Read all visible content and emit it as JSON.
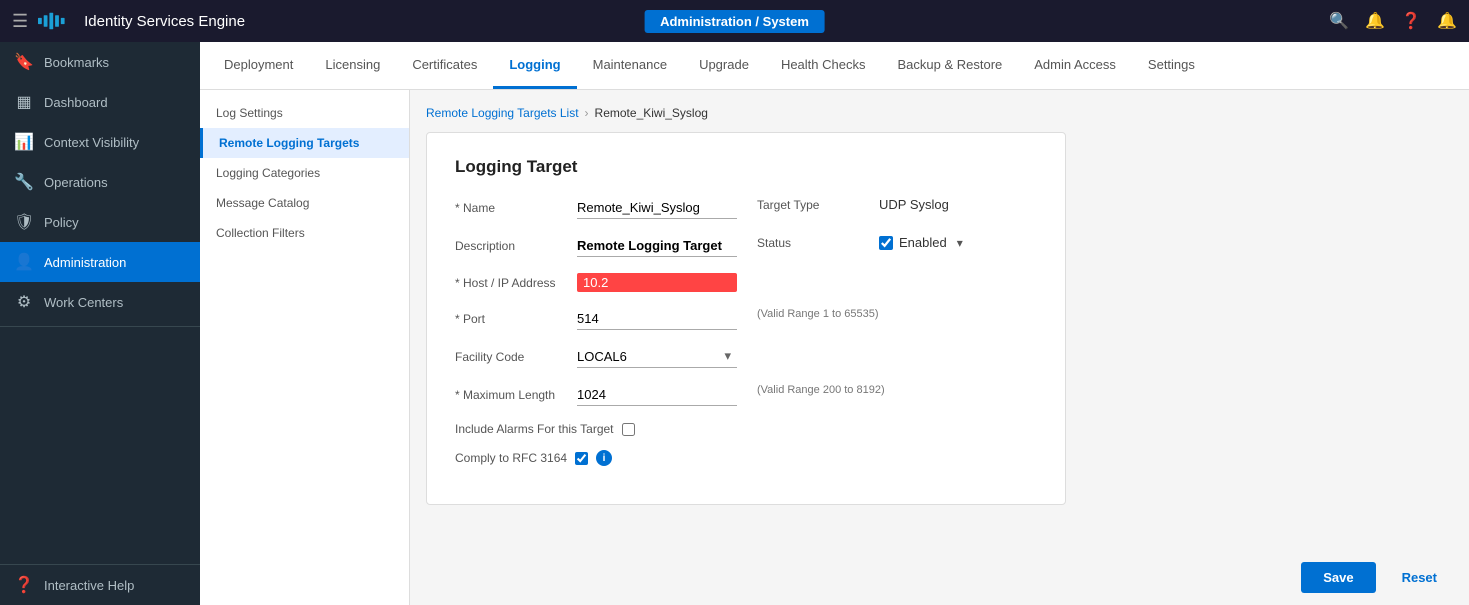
{
  "app": {
    "title": "Identity Services Engine",
    "breadcrumb": "Administration / System"
  },
  "sidebar": {
    "items": [
      {
        "id": "bookmarks",
        "label": "Bookmarks",
        "icon": "🔖"
      },
      {
        "id": "dashboard",
        "label": "Dashboard",
        "icon": "▦"
      },
      {
        "id": "context-visibility",
        "label": "Context Visibility",
        "icon": "📊"
      },
      {
        "id": "operations",
        "label": "Operations",
        "icon": "🔧"
      },
      {
        "id": "policy",
        "label": "Policy",
        "icon": "🛡"
      },
      {
        "id": "administration",
        "label": "Administration",
        "icon": "👤"
      },
      {
        "id": "work-centers",
        "label": "Work Centers",
        "icon": "⚙"
      }
    ],
    "bottom": [
      {
        "id": "interactive-help",
        "label": "Interactive Help",
        "icon": "?"
      }
    ]
  },
  "tabs": [
    {
      "id": "deployment",
      "label": "Deployment",
      "active": false
    },
    {
      "id": "licensing",
      "label": "Licensing",
      "active": false
    },
    {
      "id": "certificates",
      "label": "Certificates",
      "active": false
    },
    {
      "id": "logging",
      "label": "Logging",
      "active": true
    },
    {
      "id": "maintenance",
      "label": "Maintenance",
      "active": false
    },
    {
      "id": "upgrade",
      "label": "Upgrade",
      "active": false
    },
    {
      "id": "health-checks",
      "label": "Health Checks",
      "active": false
    },
    {
      "id": "backup-restore",
      "label": "Backup & Restore",
      "active": false
    },
    {
      "id": "admin-access",
      "label": "Admin Access",
      "active": false
    },
    {
      "id": "settings",
      "label": "Settings",
      "active": false
    }
  ],
  "sub_nav": [
    {
      "id": "log-settings",
      "label": "Log Settings",
      "active": false
    },
    {
      "id": "remote-logging-targets",
      "label": "Remote Logging Targets",
      "active": true
    },
    {
      "id": "logging-categories",
      "label": "Logging Categories",
      "active": false
    },
    {
      "id": "message-catalog",
      "label": "Message Catalog",
      "active": false
    },
    {
      "id": "collection-filters",
      "label": "Collection Filters",
      "active": false
    }
  ],
  "breadcrumb_trail": {
    "link_label": "Remote Logging Targets List",
    "current": "Remote_Kiwi_Syslog"
  },
  "form": {
    "title": "Logging Target",
    "fields": {
      "name_label": "* Name",
      "name_value": "Remote_Kiwi_Syslog",
      "target_type_label": "Target Type",
      "target_type_value": "UDP Syslog",
      "description_label": "Description",
      "description_value": "Remote Logging Target",
      "status_label": "Status",
      "status_value": "Enabled",
      "host_label": "* Host / IP Address",
      "host_value": "10.2",
      "port_label": "* Port",
      "port_value": "514",
      "port_hint": "(Valid Range 1 to 65535)",
      "facility_label": "Facility Code",
      "facility_value": "LOCAL6",
      "max_length_label": "* Maximum Length",
      "max_length_value": "1024",
      "max_length_hint": "(Valid Range 200 to 8192)",
      "include_alarms_label": "Include Alarms For this Target",
      "comply_rfc_label": "Comply to RFC 3164"
    }
  },
  "actions": {
    "save_label": "Save",
    "reset_label": "Reset"
  }
}
